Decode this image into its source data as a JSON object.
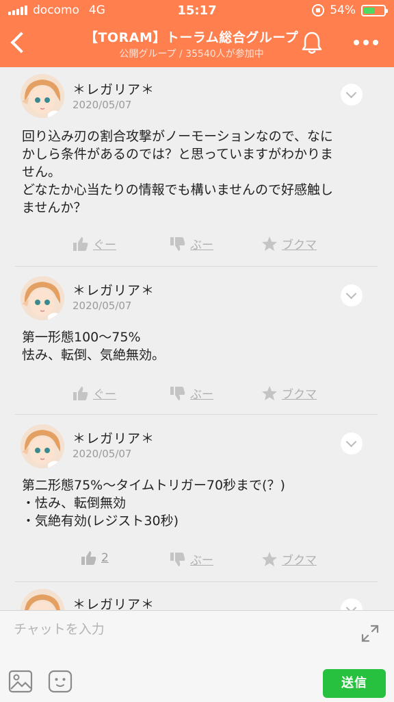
{
  "status_bar": {
    "carrier": "docomo",
    "network": "4G",
    "time": "15:17",
    "battery_percent_label": "54%",
    "battery_level": 0.54
  },
  "header": {
    "title": "【TORAM】トーラム総合グループ",
    "subtitle": "公開グループ / 35540人が参加中",
    "icons": [
      "back-icon",
      "bell-icon",
      "more-icon"
    ]
  },
  "posts": [
    {
      "author": "＊レガリア＊",
      "date": "2020/05/07",
      "lines": [
        "回り込み刃の割合攻撃がノーモーションなので、なに",
        "かしら条件があるのでは？と思っていますがわかりま",
        "せん。",
        "どなたか心当たりの情報でも構いませんので好感触し",
        "ませんか？"
      ],
      "like_label": "ぐー",
      "dislike_label": "ぶー",
      "bookmark_label": "ブクマ"
    },
    {
      "author": "＊レガリア＊",
      "date": "2020/05/07",
      "lines": [
        "第一形態100〜75%",
        "怯み、転倒、気絶無効。"
      ],
      "like_label": "ぐー",
      "dislike_label": "ぶー",
      "bookmark_label": "ブクマ"
    },
    {
      "author": "＊レガリア＊",
      "date": "2020/05/07",
      "lines": [
        "第二形態75%〜タイムトリガー70秒まで(？)",
        "・怯み、転倒無効",
        "・気絶有効(レジスト30秒)"
      ],
      "like_label": "2",
      "dislike_label": "ぶー",
      "bookmark_label": "ブクマ"
    },
    {
      "author": "＊レガリア＊"
    }
  ],
  "composer": {
    "placeholder": "チャットを入力",
    "send_label": "送信"
  },
  "colors": {
    "header_bg": "#ff7f4f",
    "send_button": "#27c03f",
    "battery_fill": "#4cd964"
  }
}
